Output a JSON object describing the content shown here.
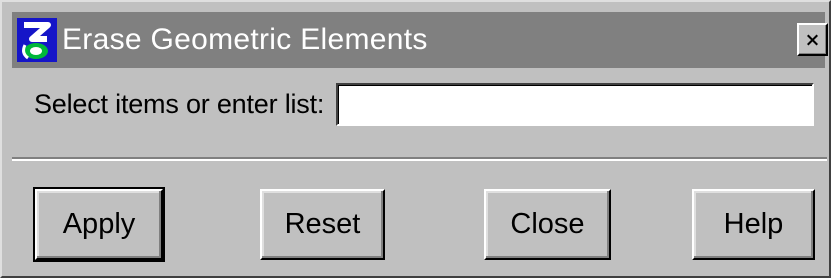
{
  "window": {
    "title": "Erase Geometric Elements",
    "close_glyph": "X",
    "app_icon": "microstation-logo-icon"
  },
  "form": {
    "select_label": "Select items or enter list:",
    "select_value": "",
    "select_placeholder": ""
  },
  "buttons": {
    "apply": "Apply",
    "reset": "Reset",
    "close": "Close",
    "help": "Help"
  },
  "colors": {
    "titlebar_inactive": "#808080",
    "face": "#c0c0c0"
  }
}
